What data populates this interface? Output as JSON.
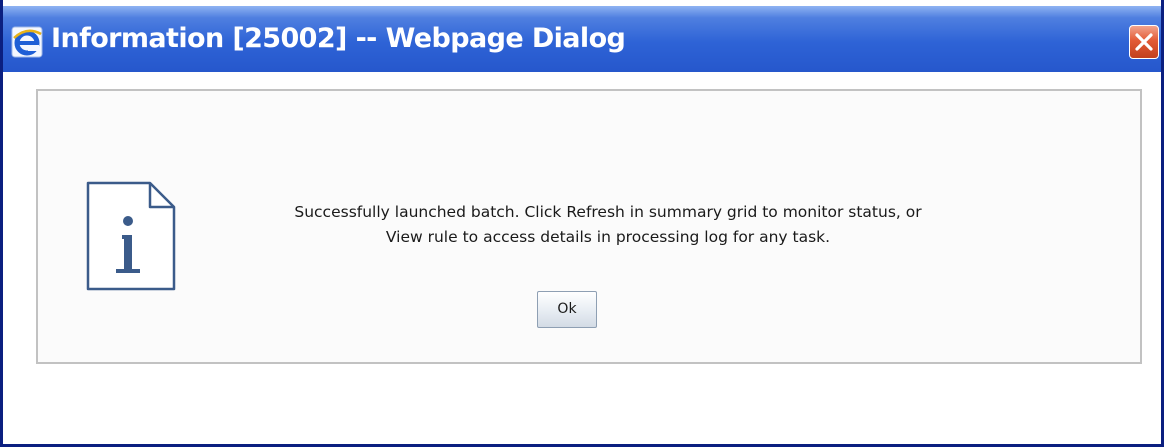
{
  "window": {
    "title": "Information [25002] -- Webpage Dialog",
    "title_icon": "ie-icon",
    "close_icon": "close-icon",
    "colors": {
      "titlebar": "#2e63d6",
      "close_button": "#e35b36",
      "frame_border": "#0b1f80"
    }
  },
  "dialog": {
    "icon": "info-icon",
    "message_lines": [
      "Successfully launched batch. Click Refresh in summary grid to monitor status, or",
      "View rule to access details in processing log for any task."
    ],
    "ok_label": "Ok"
  }
}
